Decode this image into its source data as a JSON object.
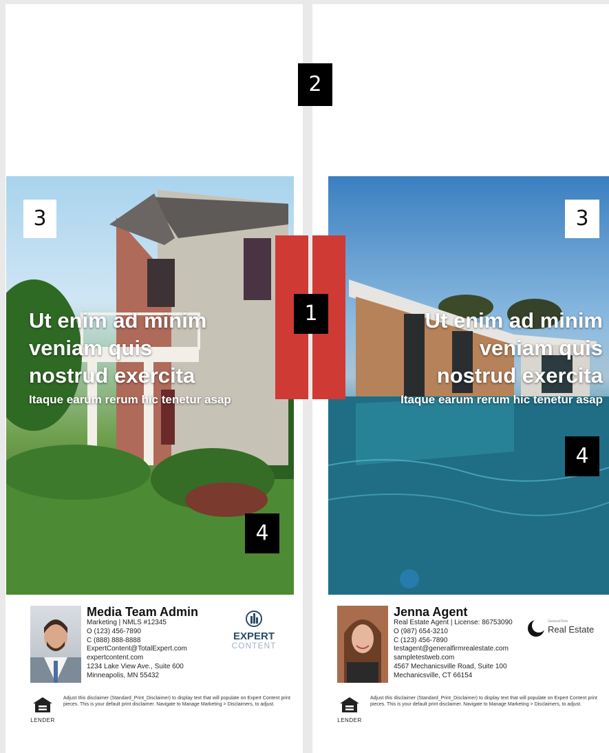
{
  "markers": {
    "m1": "1",
    "m2": "2",
    "m3_left": "3",
    "m3_right": "3",
    "m4_left": "4",
    "m4_right": "4"
  },
  "left_card": {
    "headline": "Ut enim ad minim\nveniam quis\nnostrud exercita",
    "subline": "Itaque earum rerum hic tenetur asap",
    "name": "Media Team Admin",
    "lines": [
      "Marketing | NMLS #12345",
      "O (123) 456-7890",
      "C (888) 888-8888",
      "ExpertContent@TotalExpert.com",
      "expertcontent.com",
      "1234 Lake View Ave., Suite 600",
      "Minneapolis, MN 55432"
    ],
    "logo_top": "EXPERT",
    "logo_bottom": "CONTENT",
    "ehl_label": "LENDER",
    "disclaimer": "Adjust this disclaimer (Standard_Print_Disclaimer) to display text that will populate on Expert Content print pieces. This is your default print disclaimer. Navigate to Manage Marketing > Disclaimers, to adjust."
  },
  "right_card": {
    "headline": "Ut enim ad minim\nveniam quis\nnostrud exercita",
    "subline": "Itaque earum rerum hic tenetur asap",
    "name": "Jenna Agent",
    "lines": [
      "Real Estate Agent | License: 86753090",
      "O (987) 654-3210",
      "C (123) 456-7890",
      "testagent@generalfirmrealestate.com",
      "sampletestweb.com",
      "4567 Mechanicsville Road, Suite 100",
      "Mechanicsville, CT 66154"
    ],
    "logo_small": "General Firm",
    "logo_text": "Real Estate",
    "ehl_label": "LENDER",
    "disclaimer": "Adjust this disclaimer (Standard_Print_Disclaimer) to display text that will populate on Expert Content print pieces. This is your default print disclaimer. Navigate to Manage Marketing > Disclaimers, to adjust."
  },
  "colors": {
    "accent_red": "#d03a34",
    "marker_black": "#000000"
  }
}
